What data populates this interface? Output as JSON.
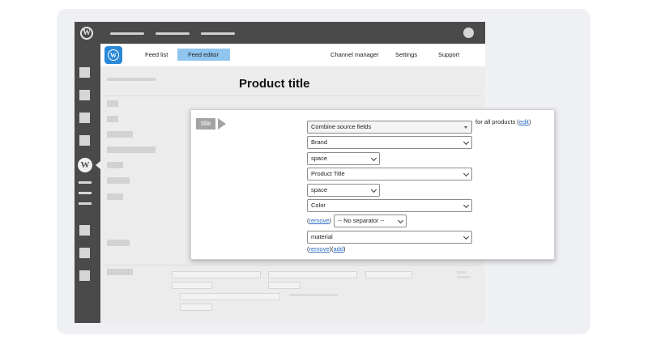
{
  "nav": {
    "items": [
      "Feed list",
      "Feed editor",
      "Channel manager",
      "Settings",
      "Support"
    ],
    "active": "Feed editor"
  },
  "page": {
    "title": "Product title"
  },
  "modal": {
    "attribute_tag": "title",
    "source_mode": "Combine source fields",
    "scope_text": "for all products",
    "edit_link": "edit",
    "fields": [
      {
        "value": "Brand"
      },
      {
        "separator": "space"
      },
      {
        "value": "Product Title"
      },
      {
        "separator": "space"
      },
      {
        "value": "Color"
      },
      {
        "remove_link": "remove",
        "separator": "-- No separator --"
      },
      {
        "value": "material"
      }
    ],
    "remove_link": "remove",
    "add_link": "add"
  },
  "colors": {
    "admin_bar": "#4a4a4a",
    "nav_active": "#8fc5ef",
    "link": "#2a6dc4",
    "tag": "#a3a3a3"
  },
  "icons": [
    "wordpress-logo-icon",
    "plugin-logo-icon",
    "chevron-down-icon",
    "dropdown-triangle-icon"
  ]
}
